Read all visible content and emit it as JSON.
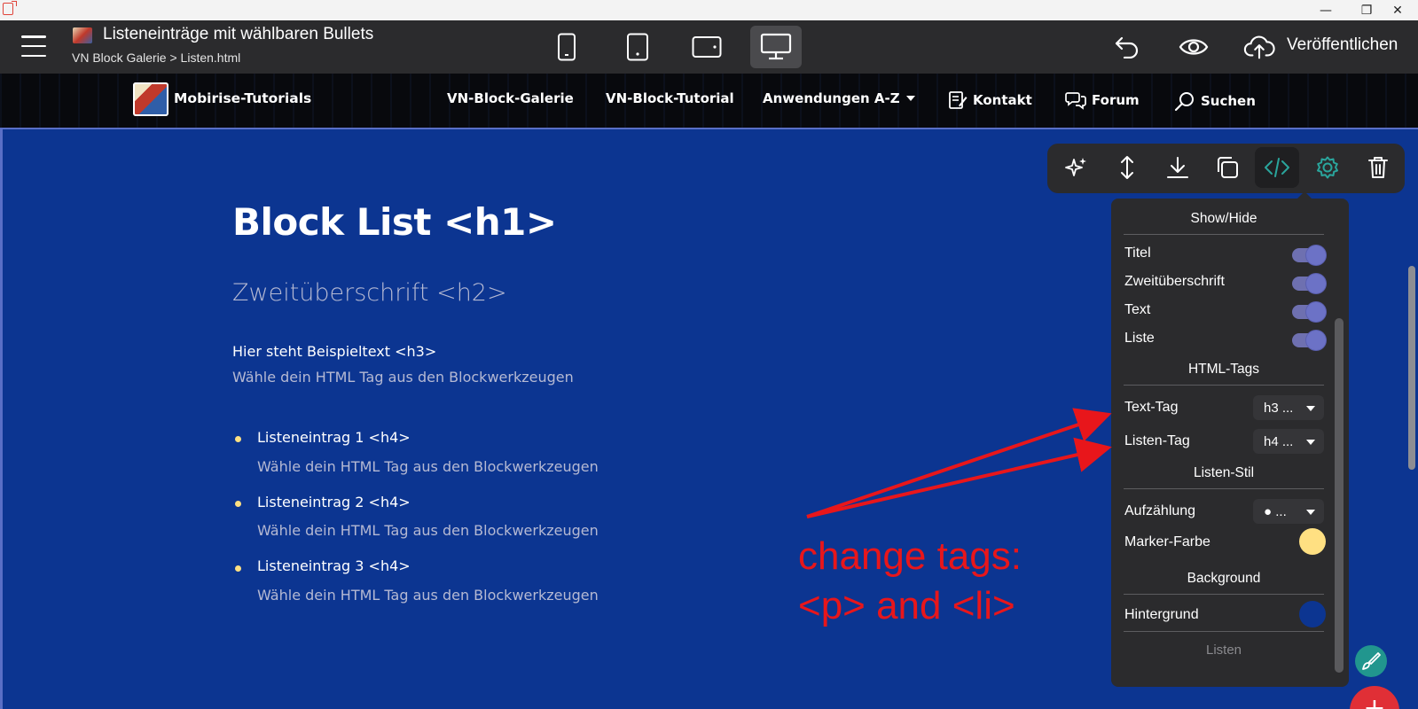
{
  "app": {
    "doc_title": "Listeneinträge mit wählbaren Bullets",
    "breadcrumb": "VN Block Galerie > Listen.html",
    "publish_label": "Veröffentlichen"
  },
  "os_controls": [
    "—",
    "❐",
    "✕"
  ],
  "site_nav": {
    "brand": "Mobirise-Tutorials",
    "links": [
      {
        "label": "VN-Block-Galerie"
      },
      {
        "label": "VN-Block-Tutorial"
      },
      {
        "label": "Anwendungen A-Z"
      },
      {
        "label": "Kontakt",
        "icon": "edit-note-icon"
      },
      {
        "label": "Forum",
        "icon": "chat-bubbles-icon"
      },
      {
        "label": "Suchen",
        "icon": "search-icon"
      }
    ]
  },
  "content": {
    "h1": "Block List <h1>",
    "h2": "Zweitüberschrift <h2>",
    "h3": "Hier steht Beispieltext <h3>",
    "subtext": "Wähle dein HTML Tag aus den Blockwerkzeugen",
    "items": [
      {
        "title": "Listeneintrag 1 <h4>",
        "desc": "Wähle dein HTML Tag aus den Blockwerkzeugen"
      },
      {
        "title": "Listeneintrag 2 <h4>",
        "desc": "Wähle dein HTML Tag aus den Blockwerkzeugen"
      },
      {
        "title": "Listeneintrag 3 <h4>",
        "desc": "Wähle dein HTML Tag aus den Blockwerkzeugen"
      }
    ],
    "bullet_color": "#ffe082"
  },
  "block_tools": [
    "sparkle-ai-icon",
    "resize-vertical-icon",
    "download-icon",
    "duplicate-icon",
    "code-icon",
    "gear-icon",
    "trash-icon"
  ],
  "panel": {
    "show_hide_heading": "Show/Hide",
    "toggles": [
      {
        "label": "Titel",
        "on": true
      },
      {
        "label": "Zweitüberschrift",
        "on": true
      },
      {
        "label": "Text",
        "on": true
      },
      {
        "label": "Liste",
        "on": true
      }
    ],
    "html_tags_heading": "HTML-Tags",
    "text_tag_label": "Text-Tag",
    "text_tag_value": "h3 ...",
    "list_tag_label": "Listen-Tag",
    "list_tag_value": "h4 ...",
    "list_style_heading": "Listen-Stil",
    "bullet_style_label": "Aufzählung",
    "bullet_style_value": "● ...",
    "marker_color_label": "Marker-Farbe",
    "marker_color": "#ffe082",
    "background_heading": "Background",
    "background_label": "Hintergrund",
    "background_color": "#0c3591",
    "footer_label": "Listen"
  },
  "annotation": {
    "line1": "change tags:",
    "line2": "<p> and <li>"
  }
}
